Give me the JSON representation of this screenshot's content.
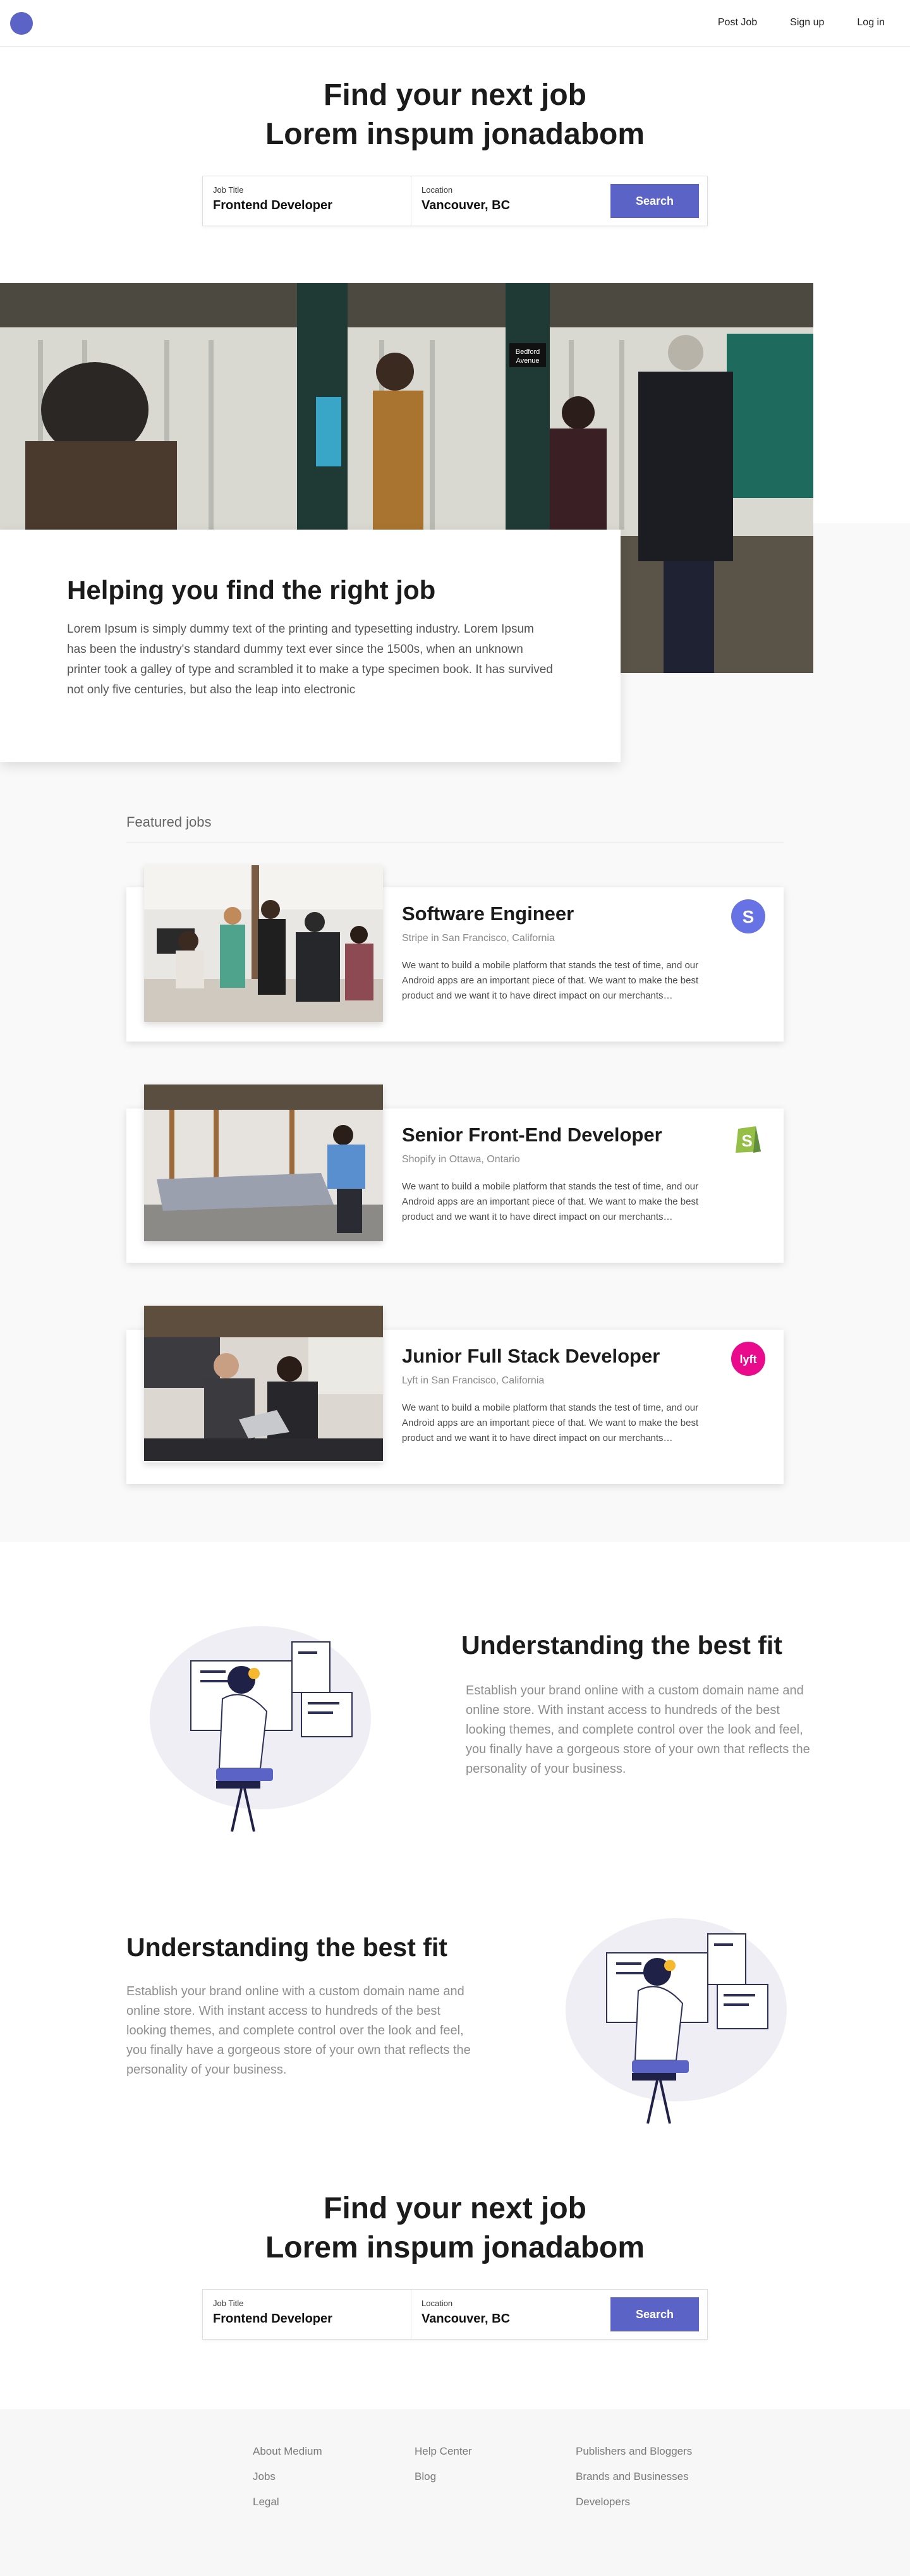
{
  "nav": {
    "links": [
      "Post Job",
      "Sign up",
      "Log in"
    ]
  },
  "hero": {
    "title_line1": "Find your next job",
    "title_line2": "Lorem inspum jonadabom",
    "search": {
      "job_title_label": "Job Title",
      "job_title_value": "Frontend Developer",
      "location_label": "Location",
      "location_value": "Vancouver, BC",
      "button": "Search"
    }
  },
  "banner": {
    "sign_text_line1": "Bedford",
    "sign_text_line2": "Avenue"
  },
  "helping": {
    "title": "Helping you find the right job",
    "text": "Lorem Ipsum is simply dummy text of the printing and typesetting industry. Lorem Ipsum has been the industry's standard dummy text ever since the 1500s, when an unknown printer took a galley of type and scrambled it to make a type specimen book. It has survived not only five centuries, but also the leap into electronic"
  },
  "featured": {
    "heading": "Featured jobs",
    "jobs": [
      {
        "title": "Software Engineer",
        "company": "Stripe in San Francisco, California",
        "description": "We want to build a mobile platform that stands the test of time, and our Android apps are an important piece of that. We want to make the best product and we want it to have direct impact on our merchants…",
        "logo": "stripe-logo",
        "logo_letter": "S",
        "logo_color": "#6772e5"
      },
      {
        "title": "Senior Front-End Developer",
        "company": "Shopify in Ottawa, Ontario",
        "description": "We want to build a mobile platform that stands the test of time, and our Android apps are an important piece of that. We want to make the best product and we want it to have direct impact on our merchants…",
        "logo": "shopify-logo",
        "logo_letter": "S",
        "logo_color": "#95bf47"
      },
      {
        "title": "Junior Full Stack Developer",
        "company": "Lyft in San Francisco, California",
        "description": "We want to build a mobile platform that stands the test of time, and our Android apps are an important piece of that. We want to make the best product and we want it to have direct impact on our merchants…",
        "logo": "lyft-logo",
        "logo_letter": "lyft",
        "logo_color": "#ea0b8c"
      }
    ]
  },
  "fit": [
    {
      "title": "Understanding the best fit",
      "text": "Establish your brand online with a custom domain name and online store. With instant access to hundreds of the best looking themes, and complete control over the look and feel, you finally have a gorgeous store of your own that reflects the personality of your business."
    },
    {
      "title": "Understanding the best fit",
      "text": "Establish your brand online with a custom domain name and online store. With instant access to hundreds of the best looking themes, and complete control over the look and feel, you finally have a gorgeous store of your own that reflects the personality of your business."
    }
  ],
  "cta": {
    "title_line1": "Find your next job",
    "title_line2": "Lorem inspum jonadabom",
    "search": {
      "job_title_label": "Job Title",
      "job_title_value": "Frontend Developer",
      "location_label": "Location",
      "location_value": "Vancouver, BC",
      "button": "Search"
    }
  },
  "footer": {
    "col1": [
      "About Medium",
      "Jobs",
      "Legal"
    ],
    "col2": [
      "Help Center",
      "Blog"
    ],
    "col3": [
      "Publishers and Bloggers",
      "Brands and Businesses",
      "Developers"
    ]
  },
  "colors": {
    "accent": "#5b64c6",
    "text_dark": "#1b1b1b",
    "text_muted": "#8e8e8e",
    "band": "#f9f9f9"
  }
}
